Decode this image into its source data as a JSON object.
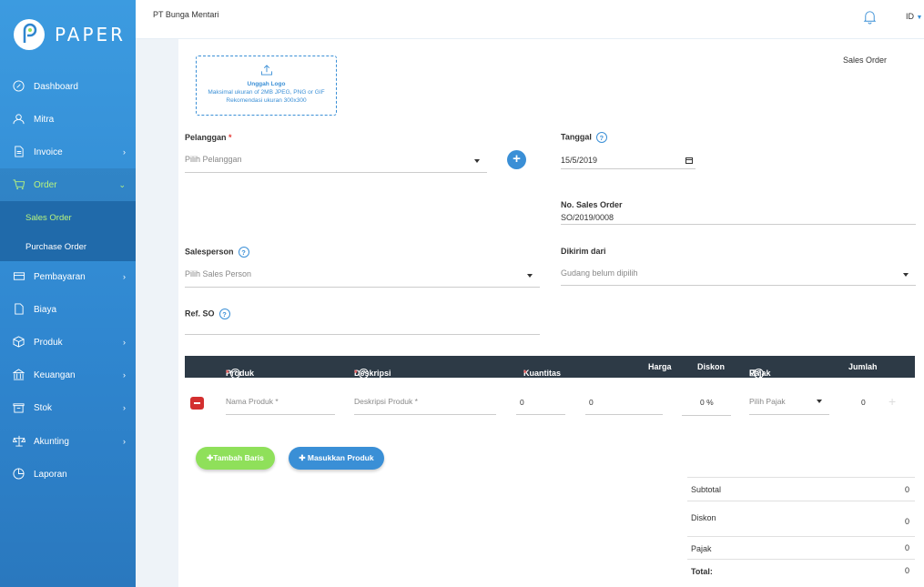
{
  "brand": {
    "name": "PAPER"
  },
  "sidebar": {
    "items": [
      {
        "label": "Dashboard",
        "icon": "dashboard-icon"
      },
      {
        "label": "Mitra",
        "icon": "user-icon"
      },
      {
        "label": "Invoice",
        "icon": "document-icon"
      },
      {
        "label": "Order",
        "icon": "cart-icon"
      },
      {
        "label": "Pembayaran",
        "icon": "card-icon"
      },
      {
        "label": "Biaya",
        "icon": "receipt-icon"
      },
      {
        "label": "Produk",
        "icon": "box-icon"
      },
      {
        "label": "Keuangan",
        "icon": "bank-icon"
      },
      {
        "label": "Stok",
        "icon": "warehouse-icon"
      },
      {
        "label": "Akunting",
        "icon": "scale-icon"
      },
      {
        "label": "Laporan",
        "icon": "pie-chart-icon"
      }
    ],
    "sub_items": [
      {
        "label": "Sales Order"
      },
      {
        "label": "Purchase Order"
      }
    ]
  },
  "header": {
    "company": "PT Bunga Mentari",
    "lang": "ID"
  },
  "upload": {
    "title": "Unggah Logo",
    "line1": "Maksimal ukuran of 2MB JPEG, PNG or GIF",
    "line2": "Rekomendasi ukuran 300x300"
  },
  "doc_type": "Sales Order",
  "form": {
    "pelanggan_label": "Pelanggan",
    "pelanggan_placeholder": "Pilih Pelanggan",
    "tanggal_label": "Tanggal",
    "tanggal_value": "15/5/2019",
    "no_so_label": "No. Sales Order",
    "no_so_value": "SO/2019/0008",
    "salesperson_label": "Salesperson",
    "salesperson_placeholder": "Pilih Sales Person",
    "dikirim_label": "Dikirim dari",
    "dikirim_placeholder": "Gudang belum dipilih",
    "ref_label": "Ref. SO"
  },
  "table": {
    "headers": {
      "produk": "Produk",
      "deskripsi": "Deskripsi",
      "kuantitas": "Kuantitas",
      "harga": "Harga",
      "diskon": "Diskon",
      "pajak": "Pajak",
      "jumlah": "Jumlah"
    },
    "row": {
      "produk_placeholder": "Nama Produk *",
      "deskripsi_placeholder": "Deskripsi Produk *",
      "kuantitas": "0",
      "harga": "0",
      "diskon": "0 %",
      "pajak_placeholder": "Pilih Pajak",
      "jumlah": "0"
    }
  },
  "buttons": {
    "tambah_baris": "Tambah Baris",
    "masukkan_produk": "Masukkan Produk"
  },
  "summary": {
    "subtotal_label": "Subtotal",
    "subtotal": "0",
    "diskon_label": "Diskon",
    "diskon": "0",
    "pajak_label": "Pajak",
    "pajak": "0",
    "total_label": "Total:",
    "total": "0"
  },
  "colors": {
    "primary": "#3a8fd6",
    "accent": "#b8f47e",
    "green": "#8fe05a",
    "dark": "#2d3a46"
  }
}
